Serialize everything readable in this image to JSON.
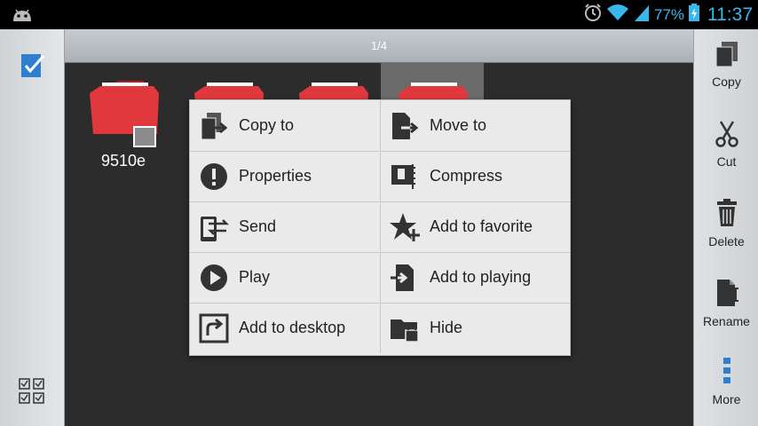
{
  "status_bar": {
    "battery_percent": "77%",
    "time": "11:37",
    "icons": [
      "android-debug-icon",
      "alarm-icon",
      "wifi-icon",
      "signal-icon",
      "battery-charging-icon"
    ],
    "accent": "#38b8ea"
  },
  "header": {
    "page_indicator": "1/4"
  },
  "folders": [
    {
      "name": "9510e",
      "selected": false
    },
    {
      "name": "",
      "selected": false
    },
    {
      "name": "",
      "selected": false
    },
    {
      "name": "",
      "selected": true
    }
  ],
  "context_menu": {
    "items": [
      {
        "label": "Copy to",
        "icon": "copy-to-icon"
      },
      {
        "label": "Move to",
        "icon": "move-to-icon"
      },
      {
        "label": "Properties",
        "icon": "info-icon"
      },
      {
        "label": "Compress",
        "icon": "compress-icon"
      },
      {
        "label": "Send",
        "icon": "send-icon"
      },
      {
        "label": "Add to favorite",
        "icon": "favorite-icon"
      },
      {
        "label": "Play",
        "icon": "play-icon"
      },
      {
        "label": "Add to playing",
        "icon": "add-to-playing-icon"
      },
      {
        "label": "Add to desktop",
        "icon": "desktop-shortcut-icon"
      },
      {
        "label": "Hide",
        "icon": "hide-folder-icon"
      }
    ]
  },
  "right_toolbar": {
    "copy_label": "Copy",
    "cut_label": "Cut",
    "delete_label": "Delete",
    "rename_label": "Rename",
    "more_label": "More"
  },
  "colors": {
    "folder_red": "#e0383c",
    "accent": "#38b8ea"
  }
}
